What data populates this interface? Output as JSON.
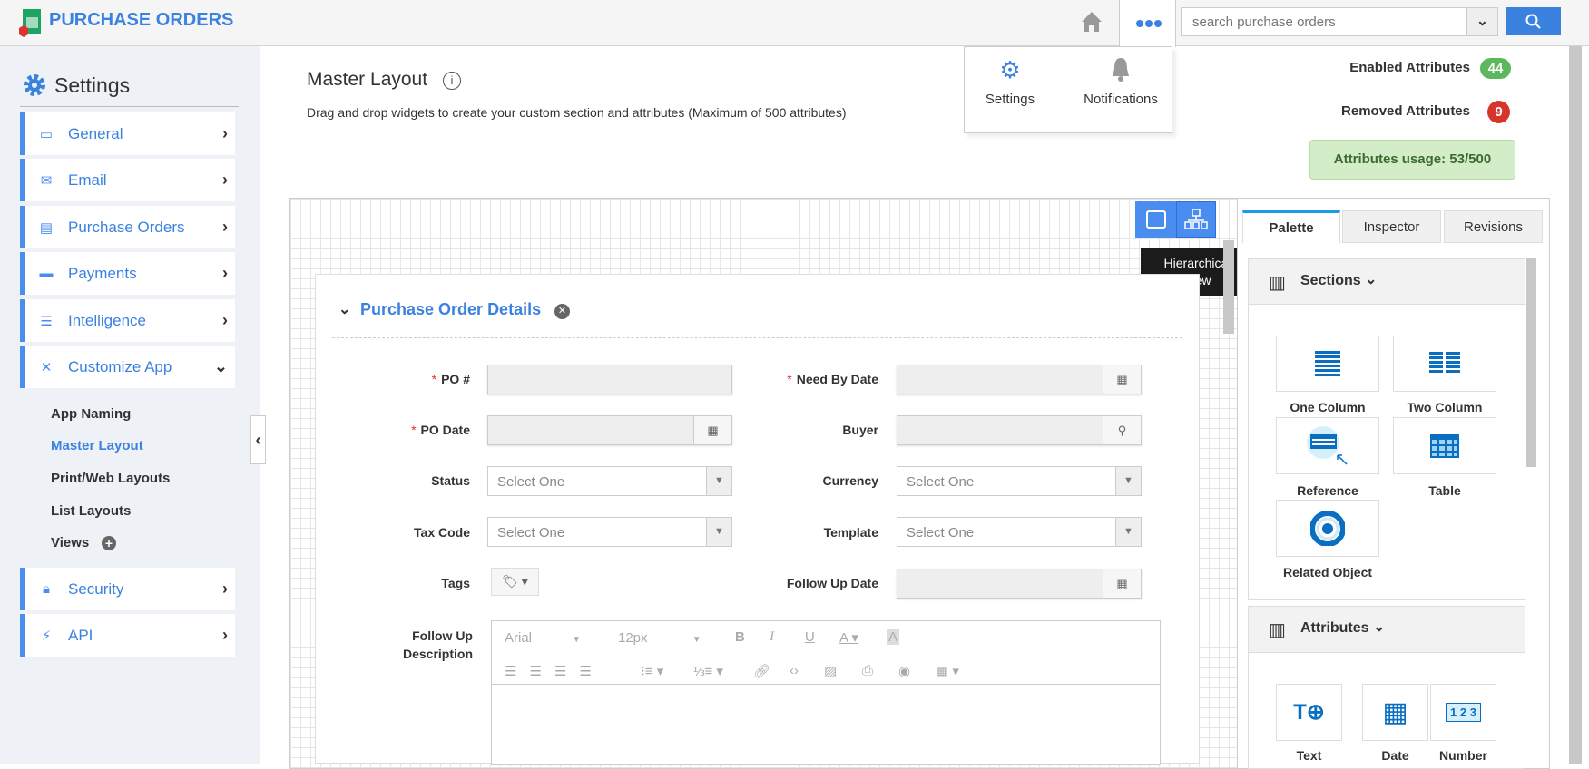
{
  "header": {
    "app_title": "PURCHASE ORDERS",
    "search_placeholder": "search purchase orders",
    "home_icon": "home-icon",
    "more_icon": "ellipsis-icon"
  },
  "popover": {
    "settings": "Settings",
    "notifications": "Notifications"
  },
  "sidebar": {
    "title": "Settings",
    "items": [
      {
        "label": "General",
        "icon": "monitor-icon"
      },
      {
        "label": "Email",
        "icon": "envelope-icon"
      },
      {
        "label": "Purchase Orders",
        "icon": "form-icon"
      },
      {
        "label": "Payments",
        "icon": "card-icon"
      },
      {
        "label": "Intelligence",
        "icon": "list-icon"
      },
      {
        "label": "Customize App",
        "icon": "tools-icon"
      }
    ],
    "sub_items": [
      {
        "label": "App Naming"
      },
      {
        "label": "Master Layout",
        "active": true
      },
      {
        "label": "Print/Web Layouts"
      },
      {
        "label": "List Layouts"
      },
      {
        "label": "Views"
      }
    ],
    "bottom_items": [
      {
        "label": "Security",
        "icon": "lock-icon"
      },
      {
        "label": "API",
        "icon": "plug-icon"
      }
    ]
  },
  "main": {
    "title": "Master Layout",
    "subtitle": "Drag and drop widgets to create your custom section and attributes (Maximum of 500 attributes)"
  },
  "stats": {
    "enabled_label": "Enabled Attributes",
    "enabled_count": "44",
    "removed_label": "Removed Attributes",
    "removed_count": "9",
    "usage": "Attributes usage: 53/500",
    "colors": {
      "enabled": "#5cb85c",
      "removed": "#d9342b",
      "usage_bg": "#d4edc9"
    }
  },
  "tooltip": "Hierarchical View",
  "section": {
    "title": "Purchase Order Details",
    "fields_left": [
      {
        "label": "PO #",
        "required": true,
        "type": "text"
      },
      {
        "label": "PO Date",
        "required": true,
        "type": "date"
      },
      {
        "label": "Status",
        "type": "select",
        "value": "Select One"
      },
      {
        "label": "Tax Code",
        "type": "select",
        "value": "Select One"
      },
      {
        "label": "Tags",
        "type": "tags"
      }
    ],
    "fields_right": [
      {
        "label": "Need By Date",
        "required": true,
        "type": "date"
      },
      {
        "label": "Buyer",
        "type": "lookup"
      },
      {
        "label": "Currency",
        "type": "select",
        "value": "Select One"
      },
      {
        "label": "Template",
        "type": "select",
        "value": "Select One"
      },
      {
        "label": "Follow Up Date",
        "type": "date"
      }
    ],
    "description_label": "Follow Up Description",
    "editor": {
      "font": "Arial",
      "size": "12px"
    }
  },
  "palette": {
    "tabs": [
      "Palette",
      "Inspector",
      "Revisions"
    ],
    "active_tab": "Palette",
    "sections_header": "Sections",
    "section_tiles": [
      "One Column",
      "Two Column",
      "Reference",
      "Table",
      "Related Object"
    ],
    "attributes_header": "Attributes",
    "attribute_tiles": [
      "Text",
      "Date",
      "Number"
    ]
  }
}
